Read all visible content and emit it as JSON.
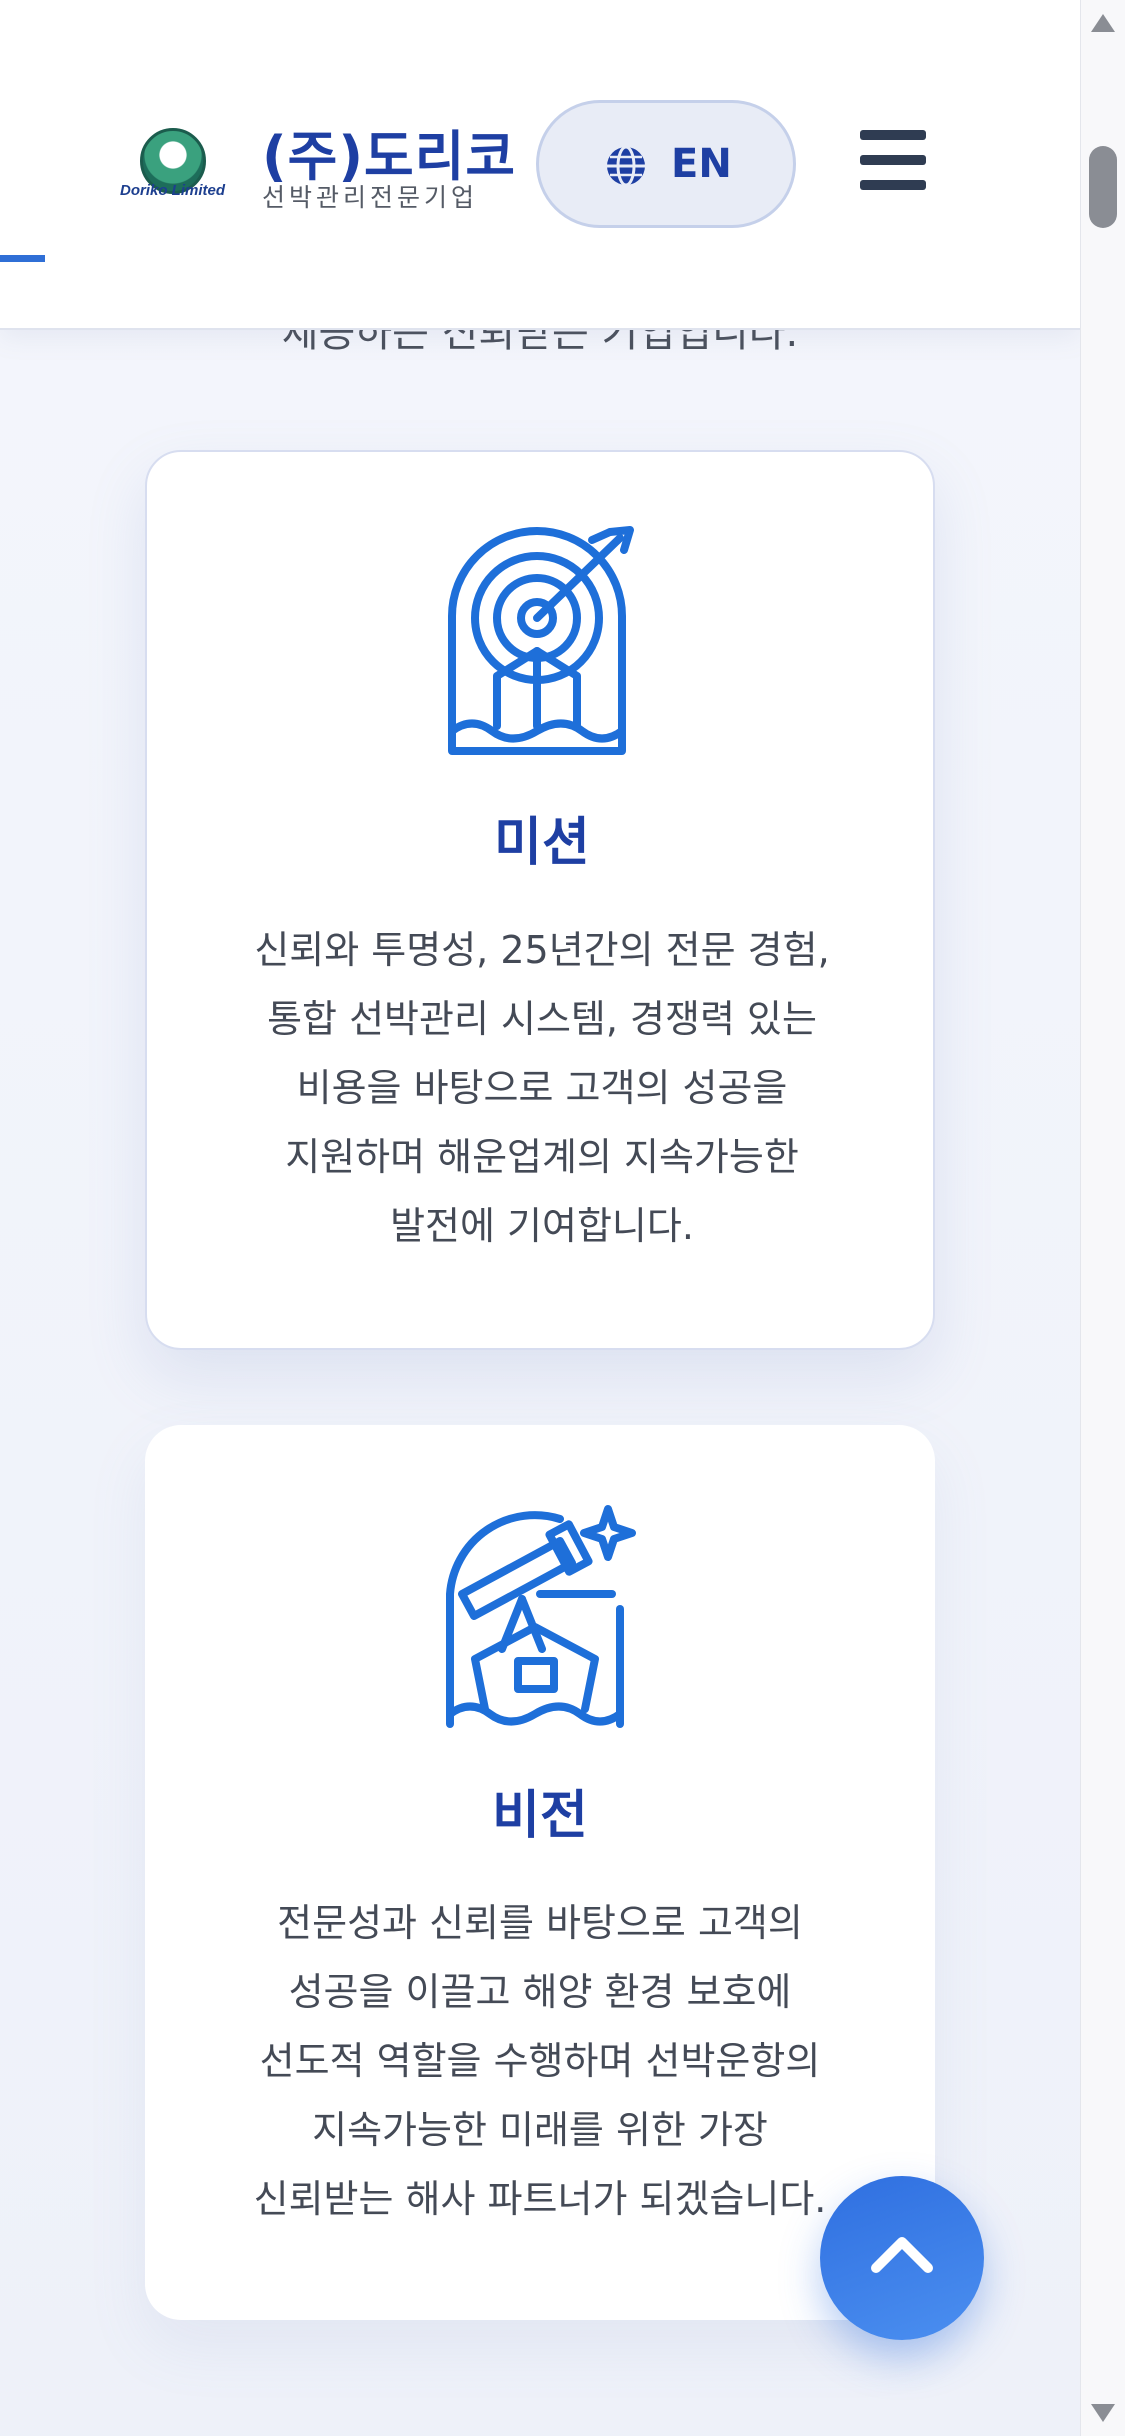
{
  "header": {
    "logo_text": "Doriko Limited",
    "brand_name": "(주)도리코",
    "brand_subtitle": "선박관리전문기업",
    "language_label": "EN"
  },
  "partial_text": "제공하는 신뢰받는 기업입니다.",
  "cards": [
    {
      "title": "미션",
      "description": "신뢰와 투명성, 25년간의 전문 경험,\n통합 선박관리 시스템, 경쟁력 있는\n비용을 바탕으로 고객의 성공을\n지원하며 해운업계의 지속가능한\n발전에 기여합니다.",
      "icon": "target-ship-icon"
    },
    {
      "title": "비전",
      "description": "전문성과 신뢰를 바탕으로 고객의\n성공을 이끌고 해양 환경 보호에\n선도적 역할을 수행하며 선박운항의\n지속가능한 미래를 위한 가장\n신뢰받는 해사 파트너가 되겠습니다.",
      "icon": "telescope-ship-icon"
    }
  ],
  "colors": {
    "brand": "#1e3fa3",
    "accent": "#2f6fd6",
    "icon": "#1e6fd9"
  }
}
